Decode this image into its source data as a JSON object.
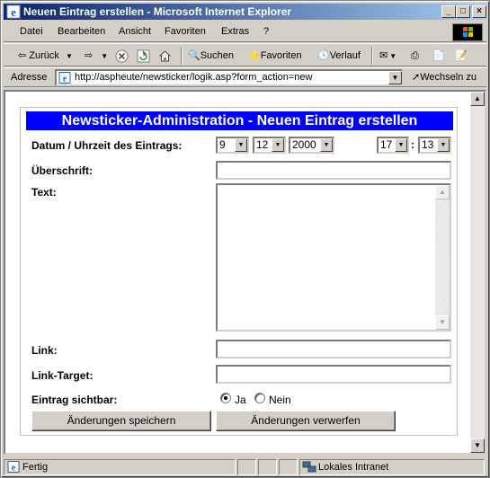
{
  "window": {
    "title": "Neuen Eintrag erstellen - Microsoft Internet Explorer",
    "controls": {
      "minimize": "_",
      "maximize": "□",
      "close": "×"
    }
  },
  "menu": [
    "Datei",
    "Bearbeiten",
    "Ansicht",
    "Favoriten",
    "Extras",
    "?"
  ],
  "toolbar": {
    "back": "Zurück",
    "search": "Suchen",
    "favorites": "Favoriten",
    "history": "Verlauf"
  },
  "address": {
    "label": "Adresse",
    "url": "http://aspheute/newsticker/logik.asp?form_action=new",
    "go": "Wechseln zu"
  },
  "form": {
    "header": "Newsticker-Administration - Neuen Eintrag erstellen",
    "date_label": "Datum / Uhrzeit des Eintrags:",
    "day": "9",
    "month": "12",
    "year": "2000",
    "hour": "17",
    "time_sep": ":",
    "minute": "13",
    "headline_label": "Überschrift:",
    "headline_value": "",
    "text_label": "Text:",
    "text_value": "",
    "link_label": "Link:",
    "link_value": "",
    "link_target_label": "Link-Target:",
    "link_target_value": "",
    "visible_label": "Eintrag sichtbar:",
    "visible_yes": "Ja",
    "visible_no": "Nein",
    "visible_selected": "Ja",
    "save_button": "Änderungen speichern",
    "discard_button": "Änderungen verwerfen"
  },
  "status": {
    "text": "Fertig",
    "zone": "Lokales Intranet"
  },
  "colors": {
    "titlebar_start": "#0a246a",
    "titlebar_end": "#a6caf0",
    "header_bg": "#0000ff",
    "chrome": "#d4d0c8"
  }
}
